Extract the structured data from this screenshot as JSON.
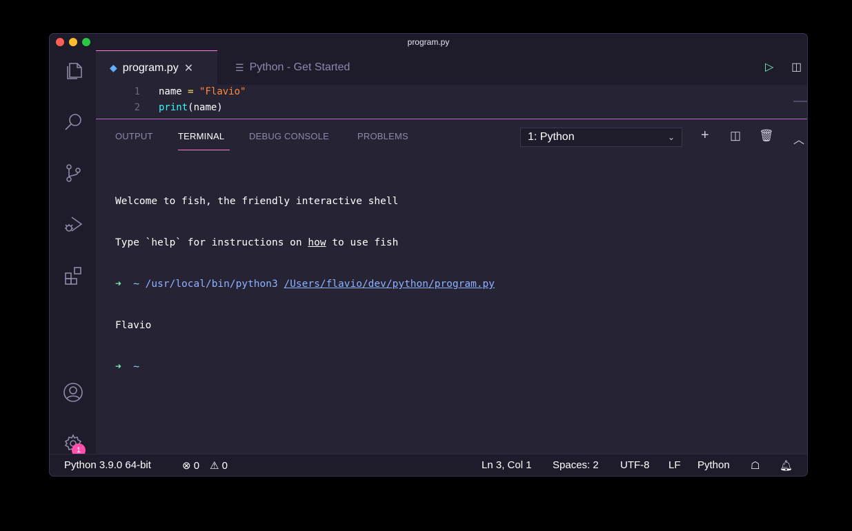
{
  "window": {
    "title": "program.py"
  },
  "activity_bar": {
    "icons": [
      "explorer-icon",
      "search-icon",
      "source-control-icon",
      "run-debug-icon",
      "extensions-icon",
      "account-icon",
      "settings-gear-icon"
    ],
    "settings_badge": "1"
  },
  "tabs": [
    {
      "label": "program.py",
      "active": true,
      "icon": "python-file-icon"
    },
    {
      "label": "Python - Get Started",
      "active": false,
      "icon": "lines-icon"
    }
  ],
  "tab_actions": [
    "run-icon",
    "split-editor-icon",
    "more-icon"
  ],
  "editor": {
    "lines": [
      {
        "number": "1",
        "var": "name",
        "op": "=",
        "str": "\"Flavio\""
      },
      {
        "number": "2",
        "fn": "print",
        "args": "(name)"
      }
    ]
  },
  "panel": {
    "tabs": [
      "OUTPUT",
      "TERMINAL",
      "DEBUG CONSOLE",
      "PROBLEMS"
    ],
    "active_tab": "TERMINAL",
    "terminal_select": "1: Python",
    "actions": [
      "plus-icon",
      "split-terminal-icon",
      "trash-icon",
      "chevron-up-icon",
      "close-icon"
    ],
    "terminal": {
      "line1": "Welcome to fish, the friendly interactive shell",
      "line2_a": "Type `help` for instructions on ",
      "line2_b": "how",
      "line2_c": " to use fish",
      "prompt_arrow": "➜",
      "prompt_tilde": "~",
      "cmd": "/usr/local/bin/python3",
      "path": "/Users/flavio/dev/python/program.py",
      "output": "Flavio"
    }
  },
  "statusbar": {
    "interpreter": "Python 3.9.0 64-bit",
    "errors": "⊗ 0",
    "warnings": "⚠ 0",
    "position": "Ln 3, Col 1",
    "spaces": "Spaces: 2",
    "encoding": "UTF-8",
    "eol": "LF",
    "language": "Python"
  }
}
